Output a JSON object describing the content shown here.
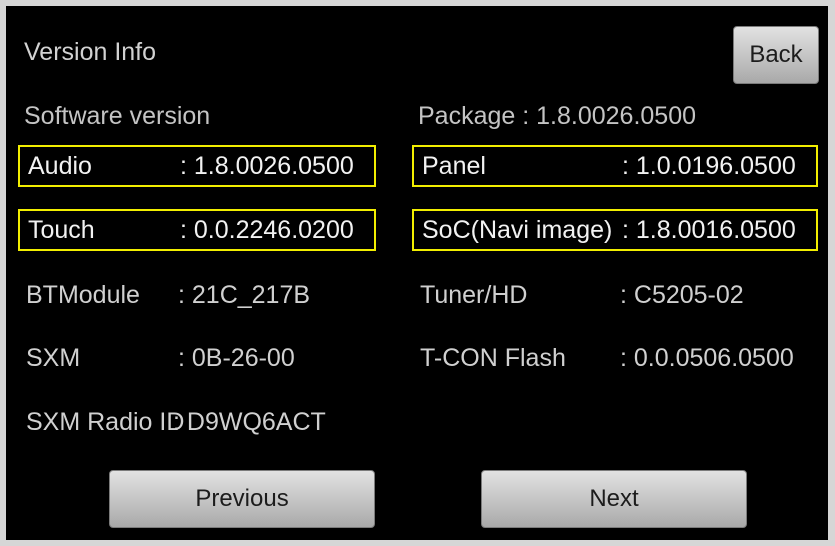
{
  "screen": {
    "title": "Version Info",
    "back_label": "Back",
    "software_version_label": "Software version",
    "package": "Package : 1.8.0026.0500"
  },
  "left_items": [
    {
      "label": "Audio",
      "value": ": 1.8.0026.0500",
      "highlighted": true
    },
    {
      "label": "Touch",
      "value": ": 0.0.2246.0200",
      "highlighted": true
    },
    {
      "label": "BTModule",
      "value": ": 21C_217B",
      "highlighted": false
    },
    {
      "label": "SXM",
      "value": ": 0B-26-00",
      "highlighted": false
    },
    {
      "label": "SXM Radio ID",
      "value": ": D9WQ6ACT",
      "highlighted": false
    }
  ],
  "right_items": [
    {
      "label": "Panel",
      "value": ": 1.0.0196.0500",
      "highlighted": true
    },
    {
      "label": "SoC(Navi image)",
      "value": ": 1.8.0016.0500",
      "highlighted": true
    },
    {
      "label": "Tuner/HD",
      "value": ": C5205-02",
      "highlighted": false
    },
    {
      "label": "T-CON Flash",
      "value": ": 0.0.0506.0500",
      "highlighted": false
    }
  ],
  "footer": {
    "previous_label": "Previous",
    "next_label": "Next"
  },
  "colors": {
    "background": "#000000",
    "highlight_border": "#f2ee00",
    "text": "#d0d0d0"
  }
}
